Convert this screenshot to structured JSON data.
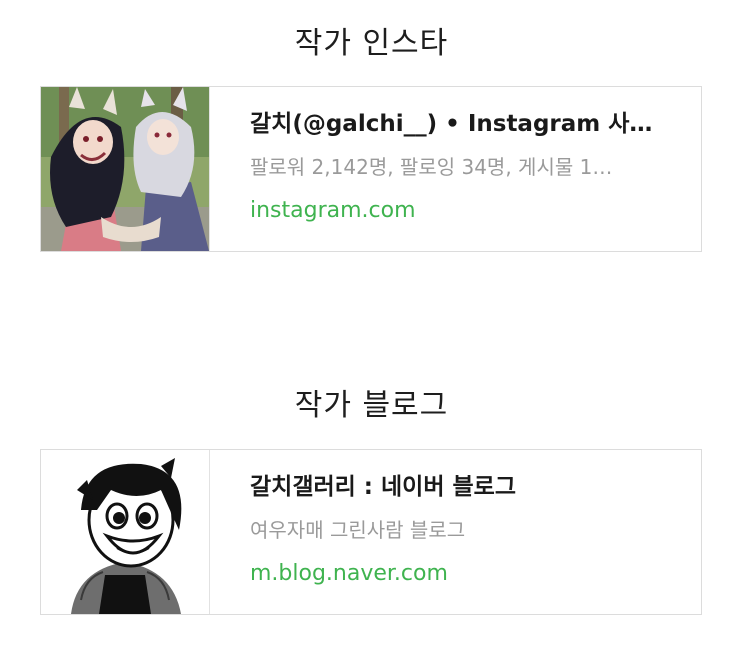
{
  "instagram_section": {
    "heading": "작가 인스타",
    "card": {
      "title": "갈치(@galchi__) • Instagram 사진…",
      "description": "팔로워 2,142명, 팔로잉 34명, 게시물 1…",
      "url": "instagram.com",
      "thumbnail": "anime-fox-girls-illustration"
    }
  },
  "blog_section": {
    "heading": "작가 블로그",
    "card": {
      "title": "갈치갤러리 : 네이버 블로그",
      "description": "여우자매 그린사람 블로그",
      "url": "m.blog.naver.com",
      "thumbnail": "smiling-boy-avatar"
    }
  },
  "colors": {
    "link": "#3fb34f",
    "border": "#dcdcdc",
    "description": "#9a9a9a"
  }
}
